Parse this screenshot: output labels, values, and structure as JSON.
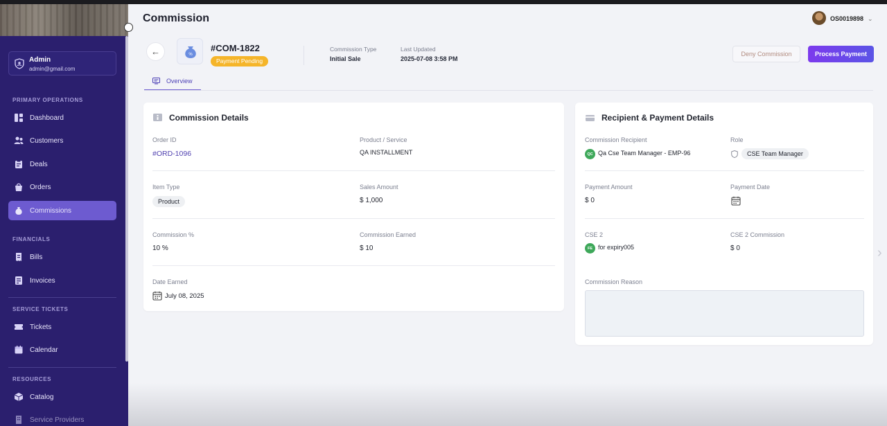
{
  "header": {
    "title": "Commission",
    "user_name": "OS0019898"
  },
  "sidebar": {
    "admin_name": "Admin",
    "admin_email": "admin@gmail.com",
    "sections": {
      "primary": "PRIMARY OPERATIONS",
      "financials": "FINANCIALS",
      "service_tickets": "SERVICE TICKETS",
      "resources": "RESOURCES"
    },
    "items": {
      "dashboard": "Dashboard",
      "customers": "Customers",
      "deals": "Deals",
      "orders": "Orders",
      "commissions": "Commissions",
      "bills": "Bills",
      "invoices": "Invoices",
      "tickets": "Tickets",
      "calendar": "Calendar",
      "catalog": "Catalog",
      "service_providers": "Service Providers"
    },
    "active_item": "Commissions"
  },
  "commission": {
    "id": "#COM-1822",
    "status": "Payment Pending",
    "type_label": "Commission Type",
    "type_value": "Initial Sale",
    "updated_label": "Last Updated",
    "updated_value": "2025-07-08 3:58 PM",
    "deny_label": "Deny Commission",
    "process_label": "Process Payment"
  },
  "tabs": {
    "overview": "Overview"
  },
  "details": {
    "title": "Commission Details",
    "order_id_label": "Order ID",
    "order_id": "#ORD-1096",
    "product_label": "Product / Service",
    "product": "QA INSTALLMENT",
    "item_type_label": "Item Type",
    "item_type": "Product",
    "sales_amount_label": "Sales Amount",
    "sales_amount": "$ 1,000",
    "commission_pct_label": "Commission %",
    "commission_pct": "10 %",
    "commission_earned_label": "Commission Earned",
    "commission_earned": "$ 10",
    "date_earned_label": "Date Earned",
    "date_earned": "July 08, 2025"
  },
  "recipient": {
    "title": "Recipient & Payment Details",
    "recipient_label": "Commission Recipient",
    "recipient_initials": "QC",
    "recipient": "Qa Cse Team Manager - EMP-96",
    "role_label": "Role",
    "role": "CSE Team Manager",
    "payment_amount_label": "Payment Amount",
    "payment_amount": "$ 0",
    "payment_date_label": "Payment Date",
    "cse2_label": "CSE 2",
    "cse2_initials": "FE",
    "cse2": "for expiry005",
    "cse2_commission_label": "CSE 2 Commission",
    "cse2_commission": "$ 0",
    "reason_label": "Commission Reason",
    "reason": ""
  },
  "colors": {
    "sidebar": "#2b1f6e",
    "accent": "#6d5bd0",
    "pending": "#f5b52a",
    "primary_button": "#7c3aed"
  }
}
